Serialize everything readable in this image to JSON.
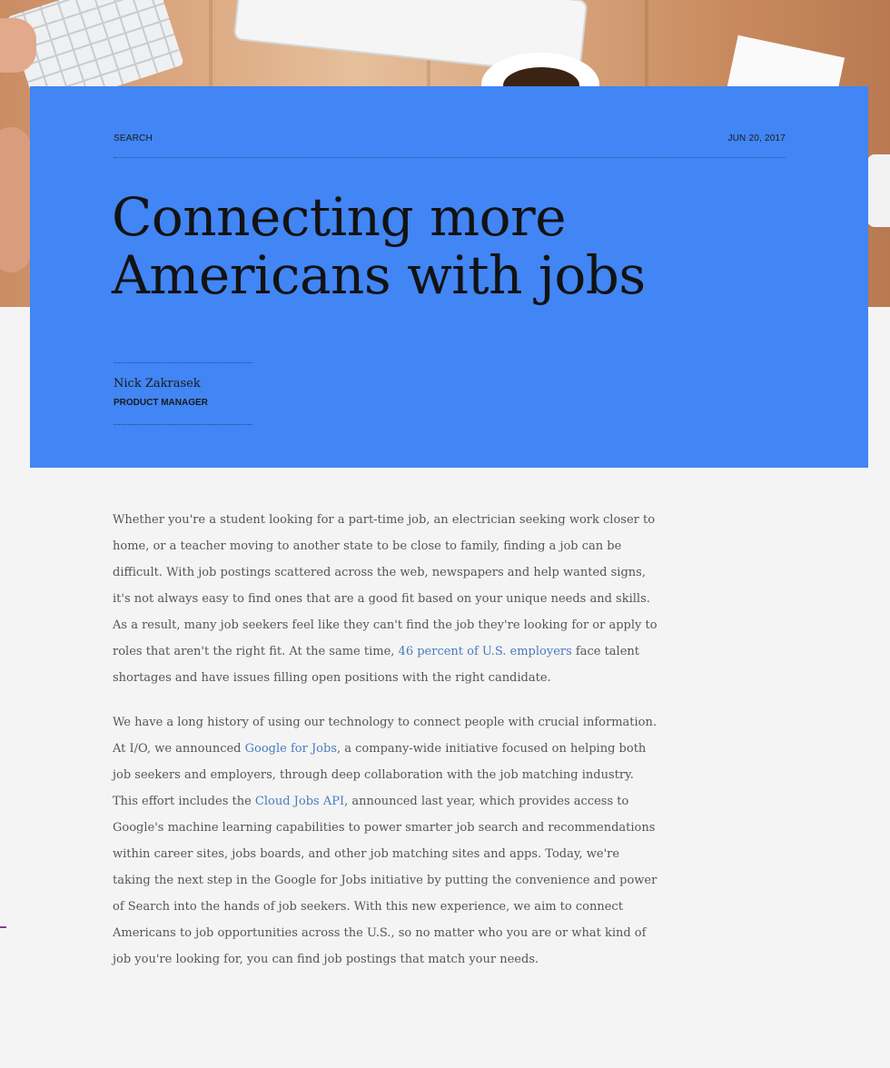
{
  "header": {
    "category": "SEARCH",
    "date": "JUN 20, 2017",
    "title_line1": "Connecting more",
    "title_line2": "Americans with jobs",
    "author_name": "Nick Zakrasek",
    "author_role": "PRODUCT MANAGER"
  },
  "article": {
    "p1_a": "Whether you're a student looking for a part-time job, an electrician seeking work closer to home, or a teacher moving to another state to be close to family, finding a job can be difficult. With job postings scattered across the web, newspapers and help wanted signs, it's not always easy to find ones that are a good fit based on your unique needs and skills. As a result, many job seekers feel like they can't find the job they're looking for or apply to roles that aren't the right fit. At the same time, ",
    "p1_link": "46 percent of U.S. employers",
    "p1_b": " face talent shortages and have issues filling open positions with the right candidate.",
    "p2_a": "We have a long history of using our technology to connect people with crucial information. At I/O, we announced ",
    "p2_link1": "Google for Jobs",
    "p2_b": ", a company-wide initiative focused on helping both job seekers and employers, through deep collaboration with the job matching industry. This effort includes the ",
    "p2_link2": "Cloud Jobs API",
    "p2_c": ", announced last year, which provides access to Google's machine learning capabilities to power smarter job search and recommendations within career sites, jobs boards, and other job matching sites and apps. Today, we're taking the next step in the Google for Jobs initiative by putting the convenience and power of Search into the hands of job seekers. With this new experience, we aim to connect Americans to job opportunities across the U.S., so no matter who you are or what kind of job you're looking for, you can find job postings that match your needs."
  },
  "colors": {
    "card": "#4285f4",
    "link": "#4a7ac0",
    "body_text": "#555555"
  }
}
